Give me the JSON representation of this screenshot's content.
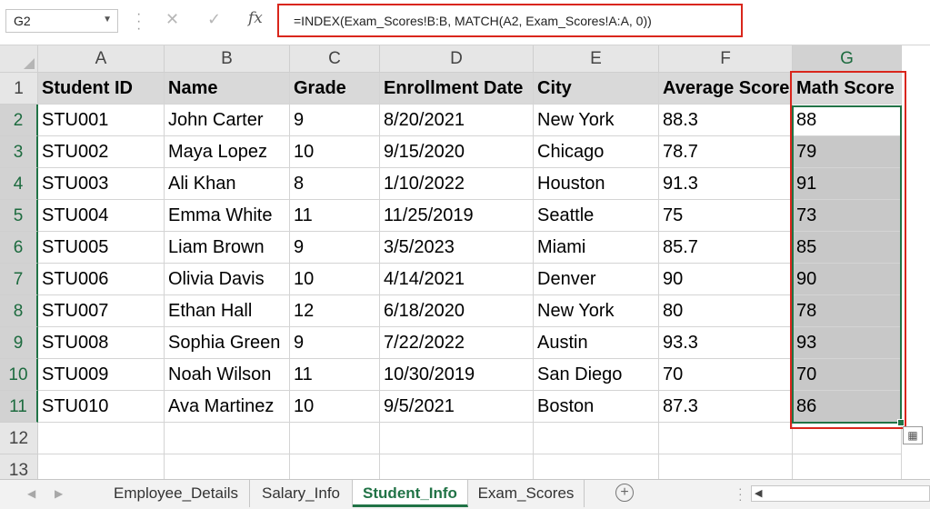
{
  "formula_bar": {
    "name_box": "G2",
    "cancel_icon": "close-icon",
    "enter_icon": "check-icon",
    "fx_label": "fx",
    "formula": "=INDEX(Exam_Scores!B:B, MATCH(A2, Exam_Scores!A:A, 0))"
  },
  "columns": [
    "A",
    "B",
    "C",
    "D",
    "E",
    "F",
    "G"
  ],
  "selected_column": "G",
  "rows": [
    "1",
    "2",
    "3",
    "4",
    "5",
    "6",
    "7",
    "8",
    "9",
    "10",
    "11",
    "12",
    "13"
  ],
  "headers": [
    "Student ID",
    "Name",
    "Grade",
    "Enrollment Date",
    "City",
    "Average Score",
    "Math Score"
  ],
  "data_rows": [
    [
      "STU001",
      "John Carter",
      "9",
      "8/20/2021",
      "New York",
      "88.3",
      "88"
    ],
    [
      "STU002",
      "Maya Lopez",
      "10",
      "9/15/2020",
      "Chicago",
      "78.7",
      "79"
    ],
    [
      "STU003",
      "Ali Khan",
      "8",
      "1/10/2022",
      "Houston",
      "91.3",
      "91"
    ],
    [
      "STU004",
      "Emma White",
      "11",
      "11/25/2019",
      "Seattle",
      "75",
      "73"
    ],
    [
      "STU005",
      "Liam Brown",
      "9",
      "3/5/2023",
      "Miami",
      "85.7",
      "85"
    ],
    [
      "STU006",
      "Olivia Davis",
      "10",
      "4/14/2021",
      "Denver",
      "90",
      "90"
    ],
    [
      "STU007",
      "Ethan Hall",
      "12",
      "6/18/2020",
      "New York",
      "80",
      "78"
    ],
    [
      "STU008",
      "Sophia Green",
      "9",
      "7/22/2022",
      "Austin",
      "93.3",
      "93"
    ],
    [
      "STU009",
      "Noah Wilson",
      "11",
      "10/30/2019",
      "San Diego",
      "70",
      "70"
    ],
    [
      "STU010",
      "Ava Martinez",
      "10",
      "9/5/2021",
      "Boston",
      "87.3",
      "86"
    ]
  ],
  "sheet_tabs": [
    "Employee_Details",
    "Salary_Info",
    "Student_Info",
    "Exam_Scores"
  ],
  "active_tab": "Student_Info",
  "colors": {
    "accent_green": "#217346",
    "highlight_red": "#d9261c",
    "selection_fill": "#c8c8c8"
  }
}
